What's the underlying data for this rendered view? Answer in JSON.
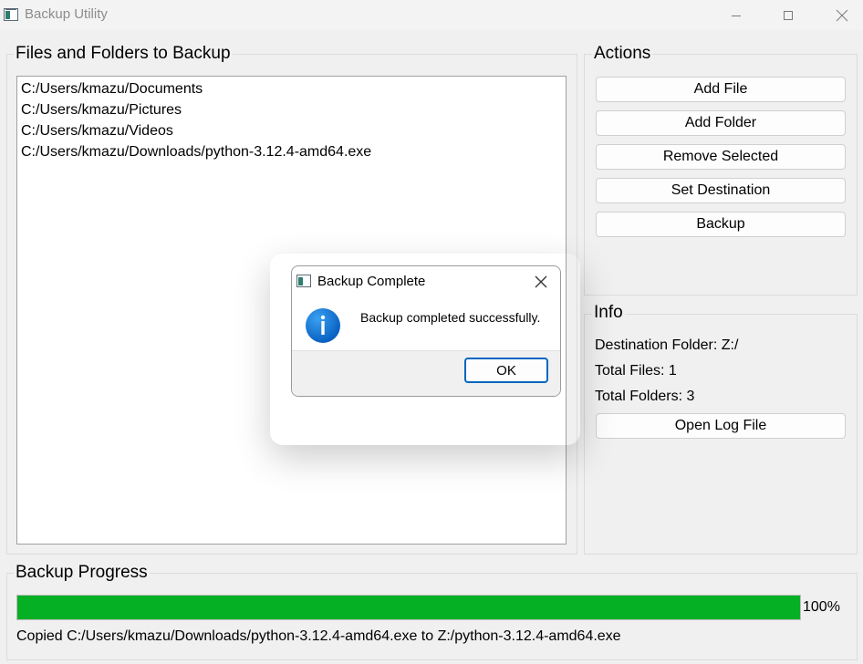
{
  "window": {
    "title": "Backup Utility"
  },
  "files_panel": {
    "title": "Files and Folders to Backup",
    "items": [
      "C:/Users/kmazu/Documents",
      "C:/Users/kmazu/Pictures",
      "C:/Users/kmazu/Videos",
      "C:/Users/kmazu/Downloads/python-3.12.4-amd64.exe"
    ]
  },
  "actions": {
    "title": "Actions",
    "add_file": "Add File",
    "add_folder": "Add Folder",
    "remove_selected": "Remove Selected",
    "set_destination": "Set Destination",
    "backup": "Backup"
  },
  "info": {
    "title": "Info",
    "destination": "Destination Folder: Z:/",
    "total_files": "Total Files: 1",
    "total_folders": "Total Folders: 3",
    "open_log": "Open Log File"
  },
  "progress": {
    "title": "Backup Progress",
    "value": 100,
    "percent_text": "100%",
    "status": "Copied C:/Users/kmazu/Downloads/python-3.12.4-amd64.exe to Z:/python-3.12.4-amd64.exe",
    "fill_color": "#06b025"
  },
  "dialog": {
    "title": "Backup Complete",
    "message": "Backup completed successfully.",
    "ok_label": "OK",
    "icon": "info-icon",
    "icon_color": "#0a74d6"
  }
}
